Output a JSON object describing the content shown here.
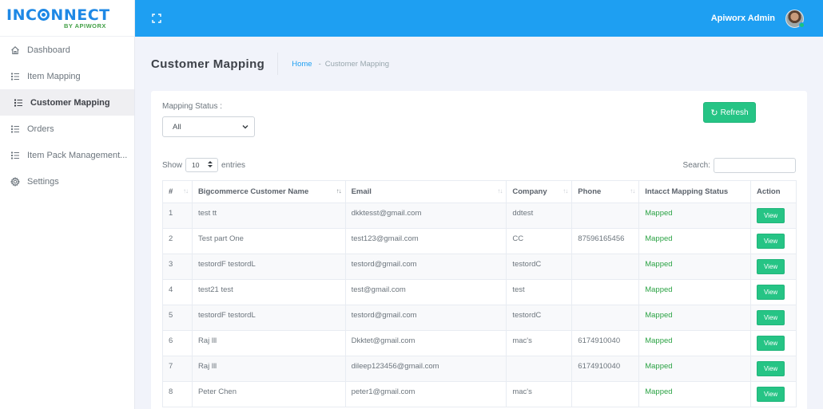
{
  "brand": {
    "name_prefix": "INC",
    "name_suffix": "NNECT",
    "tagline": "BY APIWORX"
  },
  "sidebar": {
    "items": [
      {
        "label": "Dashboard",
        "icon": "home-icon",
        "active": false
      },
      {
        "label": "Item Mapping",
        "icon": "list-icon",
        "active": false
      },
      {
        "label": "Customer Mapping",
        "icon": "list-icon",
        "active": true
      },
      {
        "label": "Orders",
        "icon": "list-icon",
        "active": false
      },
      {
        "label": "Item Pack Management...",
        "icon": "list-icon",
        "active": false
      },
      {
        "label": "Settings",
        "icon": "gear-icon",
        "active": false
      }
    ]
  },
  "topbar": {
    "user_name": "Apiworx Admin",
    "expand_icon": "fullscreen-icon"
  },
  "page": {
    "title": "Customer Mapping",
    "breadcrumb": {
      "home": "Home",
      "separator": "-",
      "current": "Customer Mapping"
    }
  },
  "filters": {
    "mapping_status_label": "Mapping Status :",
    "mapping_status_value": "All",
    "refresh_label": "Refresh",
    "show_label": "Show",
    "entries_value": "10",
    "entries_label": "entries",
    "search_label": "Search:",
    "search_value": ""
  },
  "table": {
    "headers": [
      "#",
      "Bigcommerce Customer Name",
      "Email",
      "Company",
      "Phone",
      "Intacct Mapping Status",
      "Action"
    ],
    "rows": [
      {
        "num": "1",
        "name": "test tt",
        "email": "dkktesst@gmail.com",
        "company": "ddtest",
        "phone": "",
        "status": "Mapped",
        "action": "View"
      },
      {
        "num": "2",
        "name": "Test part One",
        "email": "test123@gmail.com",
        "company": "CC",
        "phone": "87596165456",
        "status": "Mapped",
        "action": "View"
      },
      {
        "num": "3",
        "name": "testordF testordL",
        "email": "testord@gmail.com",
        "company": "testordC",
        "phone": "",
        "status": "Mapped",
        "action": "View"
      },
      {
        "num": "4",
        "name": "test21 test",
        "email": "test@gmail.com",
        "company": "test",
        "phone": "",
        "status": "Mapped",
        "action": "View"
      },
      {
        "num": "5",
        "name": "testordF testordL",
        "email": "testord@gmail.com",
        "company": "testordC",
        "phone": "",
        "status": "Mapped",
        "action": "View"
      },
      {
        "num": "6",
        "name": "Raj lll",
        "email": "Dkktet@gmail.com",
        "company": "mac's",
        "phone": "6174910040",
        "status": "Mapped",
        "action": "View"
      },
      {
        "num": "7",
        "name": "Raj lll",
        "email": "dileep123456@gmail.com",
        "company": "",
        "phone": "6174910040",
        "status": "Mapped",
        "action": "View"
      },
      {
        "num": "8",
        "name": "Peter Chen",
        "email": "peter1@gmail.com",
        "company": "mac's",
        "phone": "",
        "status": "Mapped",
        "action": "View"
      }
    ]
  },
  "colors": {
    "primary": "#1e9ff2",
    "success": "#26c485",
    "mapped_text": "#2ca345"
  }
}
